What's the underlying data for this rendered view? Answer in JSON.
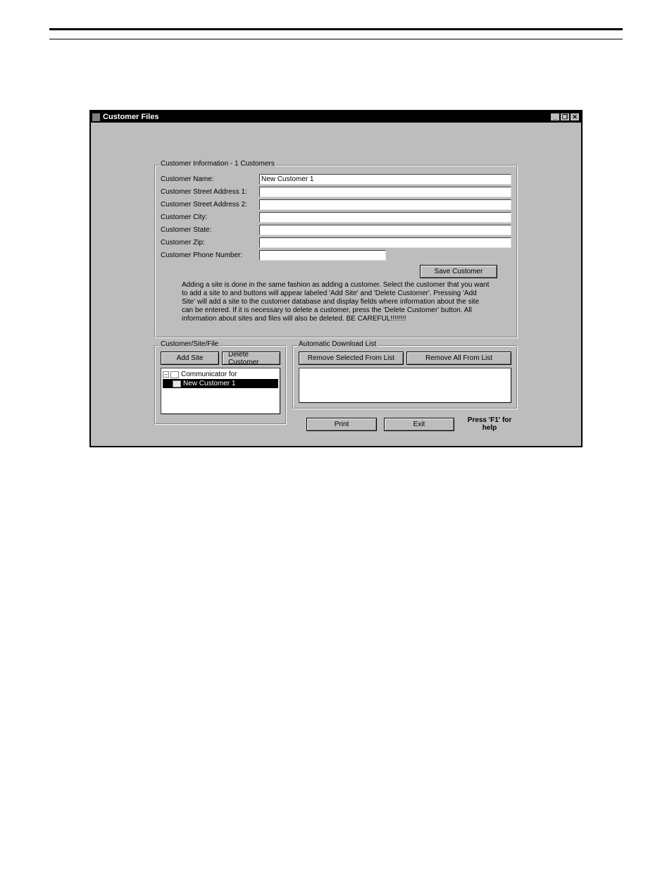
{
  "window": {
    "title": "Customer Files"
  },
  "customerInfo": {
    "groupTitle": "Customer Information - 1 Customers",
    "fields": {
      "name": {
        "label": "Customer Name:",
        "value": "New Customer 1"
      },
      "addr1": {
        "label": "Customer Street Address 1:",
        "value": ""
      },
      "addr2": {
        "label": "Customer Street Address 2:",
        "value": ""
      },
      "city": {
        "label": "Customer City:",
        "value": ""
      },
      "state": {
        "label": "Customer State:",
        "value": ""
      },
      "zip": {
        "label": "Customer Zip:",
        "value": ""
      },
      "phone": {
        "label": "Customer Phone Number:",
        "value": ""
      }
    },
    "saveButton": "Save Customer",
    "helpText": "Adding a site is done in the same fashion as adding a customer. Select the customer that you want to add a site to and buttons will appear labeled 'Add Site' and 'Delete Customer'. Pressing 'Add Site' will add a site to the customer database and display fields where information about the site can be entered. If it is necessary to delete a customer, press the 'Delete Customer' button. All information about sites and files will also be deleted. BE CAREFUL!!!!!!!!"
  },
  "csf": {
    "groupTitle": "Customer/Site/File",
    "addSite": "Add Site",
    "deleteCustomer": "Delete Customer",
    "tree": {
      "root": "Communicator for",
      "child": "New Customer 1"
    }
  },
  "adl": {
    "groupTitle": "Automatic Download List",
    "removeSelected": "Remove Selected From List",
    "removeAll": "Remove All From List"
  },
  "footer": {
    "print": "Print",
    "exit": "Exit",
    "helpHint": "Press 'F1' for help"
  }
}
